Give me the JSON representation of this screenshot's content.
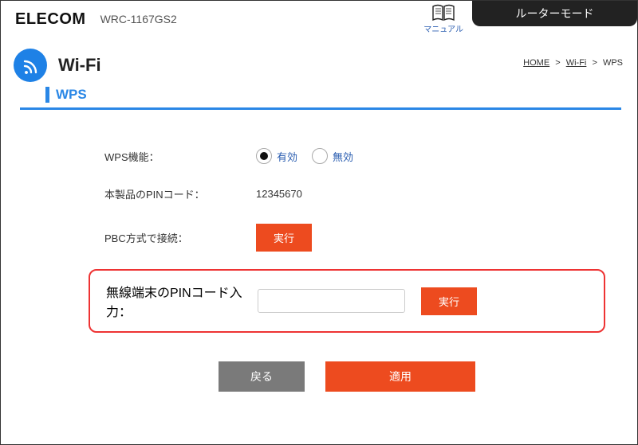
{
  "header": {
    "brand": "ELECOM",
    "model": "WRC-1167GS2",
    "manual_label": "マニュアル",
    "mode": "ルーターモード"
  },
  "page": {
    "title": "Wi-Fi",
    "section_heading": "WPS"
  },
  "breadcrumb": {
    "home": "HOME",
    "mid": "Wi-Fi",
    "current": "WPS",
    "sep": ">"
  },
  "form": {
    "wps_function_label": "WPS機能：",
    "radio_enabled": "有効",
    "radio_disabled": "無効",
    "wps_selected": "enabled",
    "pin_label": "本製品のPINコード：",
    "pin_value": "12345670",
    "pbc_label": "PBC方式で接続：",
    "pbc_button": "実行",
    "remote_pin_label": "無線端末のPINコード入力：",
    "remote_pin_value": "",
    "remote_pin_button": "実行"
  },
  "footer": {
    "back": "戻る",
    "apply": "適用"
  }
}
